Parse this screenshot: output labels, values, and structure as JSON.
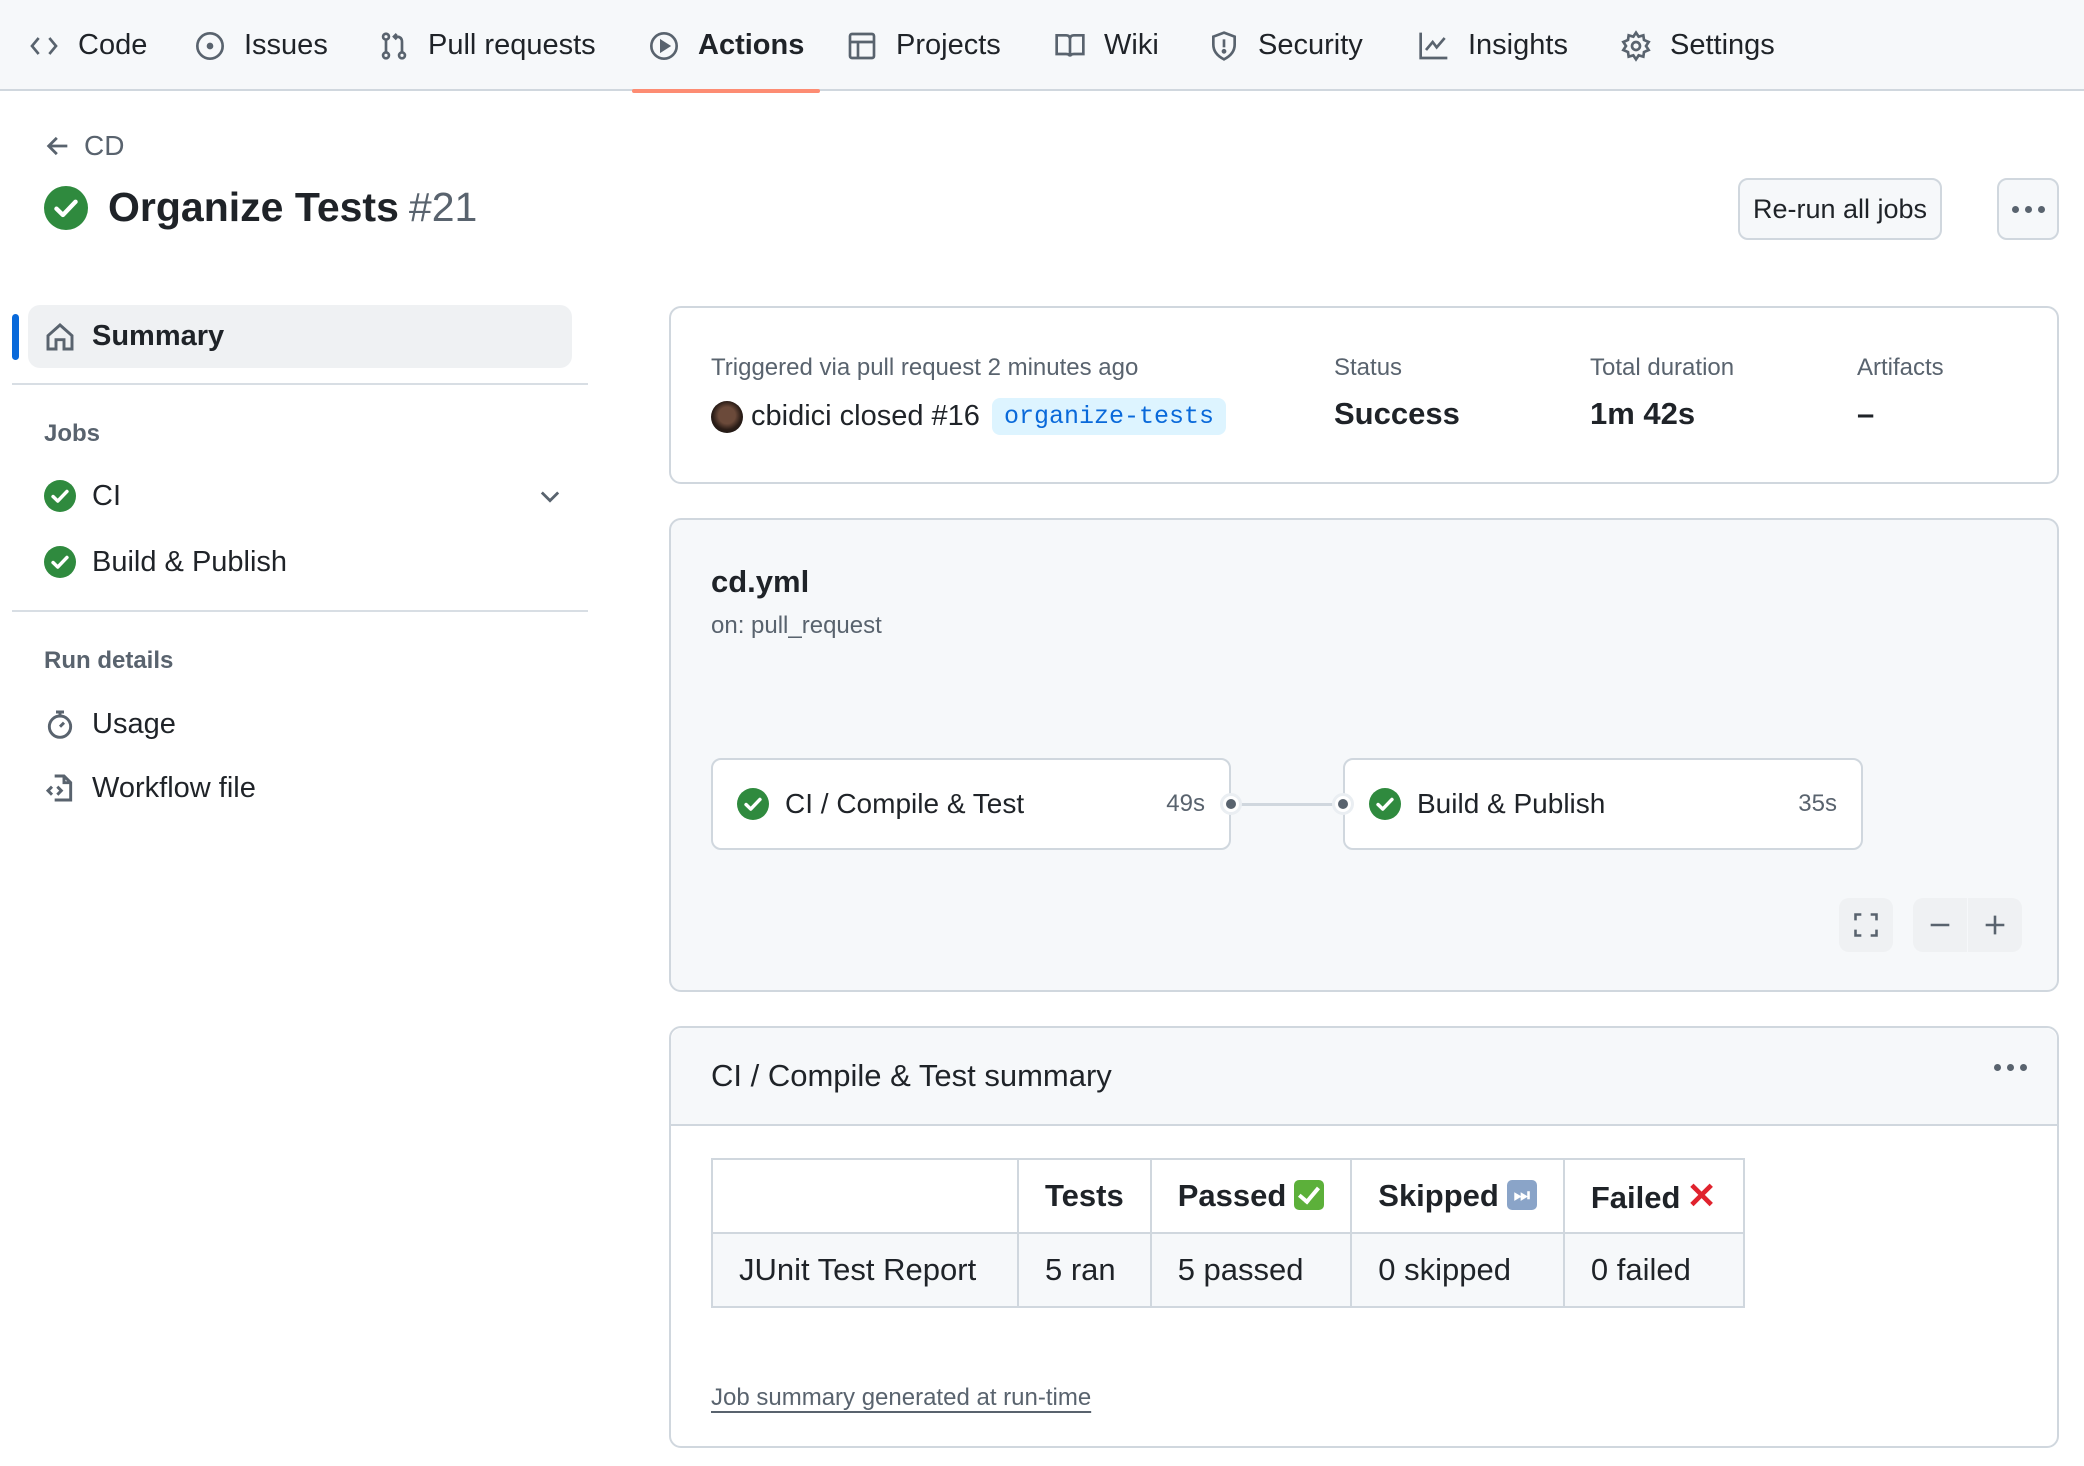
{
  "nav": {
    "tabs": [
      {
        "label": "Code",
        "icon": "code-icon"
      },
      {
        "label": "Issues",
        "icon": "issue-opened-icon"
      },
      {
        "label": "Pull requests",
        "icon": "git-pull-request-icon"
      },
      {
        "label": "Actions",
        "icon": "play-icon",
        "active": true
      },
      {
        "label": "Projects",
        "icon": "table-icon"
      },
      {
        "label": "Wiki",
        "icon": "book-icon"
      },
      {
        "label": "Security",
        "icon": "shield-icon"
      },
      {
        "label": "Insights",
        "icon": "graph-icon"
      },
      {
        "label": "Settings",
        "icon": "gear-icon"
      }
    ],
    "active_color": "#fd8c73"
  },
  "header": {
    "breadcrumb": "CD",
    "title": "Organize Tests",
    "run_number": "#21",
    "status_icon": "check-circle-fill-icon",
    "rerun_label": "Re-run all jobs"
  },
  "sidebar": {
    "summary_label": "Summary",
    "jobs_heading": "Jobs",
    "jobs": [
      {
        "label": "CI",
        "status": "success",
        "expandable": true
      },
      {
        "label": "Build & Publish",
        "status": "success"
      }
    ],
    "run_details_heading": "Run details",
    "run_details": [
      {
        "label": "Usage",
        "icon": "stopwatch-icon"
      },
      {
        "label": "Workflow file",
        "icon": "file-code-icon"
      }
    ]
  },
  "run_summary": {
    "trigger_text": "Triggered via pull request 2 minutes ago",
    "actor": "cbidici",
    "action": "closed",
    "pr": "#16",
    "branch": "organize-tests",
    "status_label": "Status",
    "status_value": "Success",
    "duration_label": "Total duration",
    "duration_value": "1m 42s",
    "artifacts_label": "Artifacts",
    "artifacts_value": "–"
  },
  "workflow": {
    "file": "cd.yml",
    "trigger": "on: pull_request",
    "jobs": [
      {
        "name": "CI / Compile & Test",
        "duration": "49s",
        "status": "success"
      },
      {
        "name": "Build & Publish",
        "duration": "35s",
        "status": "success"
      }
    ]
  },
  "job_summary": {
    "title": "CI / Compile & Test summary",
    "table": {
      "headers": [
        "",
        "Tests",
        "Passed",
        "Skipped",
        "Failed"
      ],
      "rows": [
        [
          "JUnit Test Report",
          "5 ran",
          "5 passed",
          "0 skipped",
          "0 failed"
        ]
      ]
    },
    "footer_link": "Job summary generated at run-time"
  },
  "colors": {
    "success": "#1a7f37",
    "link": "#0969da",
    "muted": "#59636e"
  }
}
